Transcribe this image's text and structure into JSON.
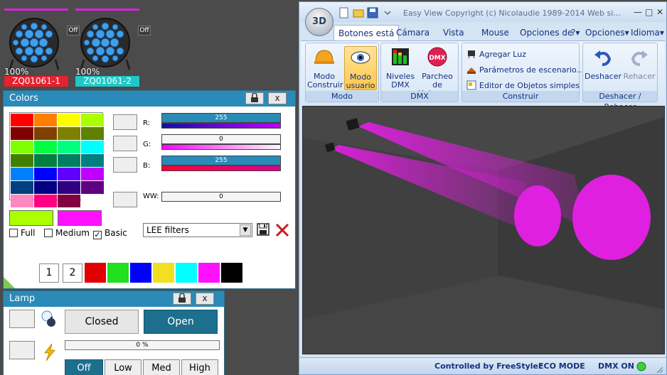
{
  "fixtures": [
    {
      "off": "Off",
      "percent": "100%",
      "name": "ZQ01061-1",
      "color": "#e8202f"
    },
    {
      "off": "Off",
      "percent": "100%",
      "name": "ZQ01061-2",
      "color": "#1ec8c8"
    }
  ],
  "colors_panel": {
    "title": "Colors",
    "lock_icon": "lock-icon",
    "close_label": "x",
    "grid_colors": [
      "#ff0000",
      "#ff8000",
      "#ffff00",
      "#aaff00",
      "#800000",
      "#804000",
      "#808000",
      "#608000",
      "#80ff00",
      "#00ff40",
      "#00ff80",
      "#00ffff",
      "#408000",
      "#008040",
      "#008060",
      "#008080",
      "#0080ff",
      "#0000ff",
      "#6000ff",
      "#c000ff",
      "#004080",
      "#000080",
      "#300080",
      "#600080",
      "#ff88c0",
      "#ff0080",
      "#800040",
      "#ffffff"
    ],
    "channels": [
      {
        "label": "R:",
        "value": "255",
        "track": "linear-gradient(90deg,#1010a0,#c000ff)"
      },
      {
        "label": "G:",
        "value": "0",
        "track": "linear-gradient(90deg,#ff00ff,#f8f8f8)"
      },
      {
        "label": "B:",
        "value": "255",
        "track": "linear-gradient(90deg,#ff0030,#e00090)"
      },
      {
        "label": "WW:",
        "value": "0",
        "track": ""
      }
    ],
    "current_colors": [
      "#aaff00",
      "#ff10ff"
    ],
    "checkboxes": [
      {
        "label": "Full",
        "checked": false
      },
      {
        "label": "Medium",
        "checked": false
      },
      {
        "label": "Basic",
        "checked": true
      }
    ],
    "filter": {
      "selected": "LEE filters",
      "arrow": "▼"
    },
    "save_icon": "floppy-icon",
    "delete_icon": "red-x-icon",
    "palette_buttons": [
      "1",
      "2"
    ],
    "palette": [
      "#e00000",
      "#20e020",
      "#0000ff",
      "#f0e020",
      "#00ffff",
      "#ff10ff",
      "#000000"
    ]
  },
  "lamp_panel": {
    "title": "Lamp",
    "close_label": "x",
    "shutter": {
      "closed": "Closed",
      "open": "Open"
    },
    "dimmer_value": "0 %",
    "levels": [
      "Off",
      "Low",
      "Med",
      "High"
    ]
  },
  "easy_view": {
    "logo": "3D",
    "title": "Easy View    Copyright (c) Nicolaudie 1989-2014    Web si...",
    "window_buttons": [
      "—",
      "□",
      "✕"
    ],
    "tabs": [
      "Botones está",
      "Cámara",
      "Vista",
      "Mouse",
      "Opciones de"
    ],
    "right_menu": [
      "?▾",
      "Opciones▾",
      "Idioma▾"
    ],
    "groups": [
      {
        "label": "Modo",
        "buttons": [
          "Modo Construir",
          "Modo usuario"
        ]
      },
      {
        "label": "DMX",
        "buttons": [
          "Niveles DMX",
          "Parcheo de Universos"
        ]
      },
      {
        "label": "Construir",
        "items": [
          "Agregar Luz",
          "Parámetros de escenario...",
          "Editor de Objetos simples"
        ]
      },
      {
        "label": "Deshacer / Rehacer",
        "buttons": [
          "Deshacer",
          "Rehacer"
        ]
      }
    ],
    "status": {
      "controlled": "Controlled by FreeStyler",
      "eco": "ECO MODE",
      "dmx": "DMX ON"
    },
    "colors": {
      "beam": "#e020e0",
      "accent": "#2a8ab8"
    }
  }
}
